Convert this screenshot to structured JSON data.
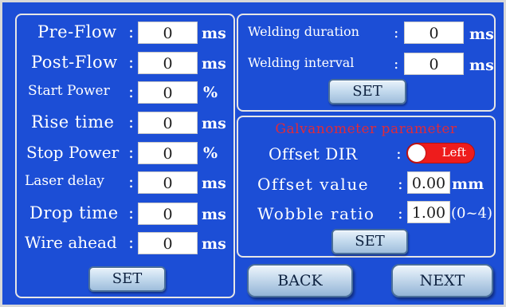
{
  "left": {
    "rows": [
      {
        "label": "Pre-Flow",
        "colon": ":",
        "value": "0",
        "unit": "ms"
      },
      {
        "label": "Post-Flow",
        "colon": ":",
        "value": "0",
        "unit": "ms"
      },
      {
        "label": "Start Power",
        "colon": ":",
        "value": "0",
        "unit": "%"
      },
      {
        "label": "Rise time",
        "colon": ":",
        "value": "0",
        "unit": "ms"
      },
      {
        "label": "Stop Power",
        "colon": ":",
        "value": "0",
        "unit": "%"
      },
      {
        "label": "Laser delay",
        "colon": ":",
        "value": "0",
        "unit": "ms"
      },
      {
        "label": "Drop time",
        "colon": ":",
        "value": "0",
        "unit": "ms"
      },
      {
        "label": "Wire ahead",
        "colon": ":",
        "value": "0",
        "unit": "ms"
      }
    ],
    "set_label": "SET"
  },
  "welding": {
    "duration_label": "Welding duration",
    "duration_colon": ":",
    "duration_value": "0",
    "duration_unit": "ms",
    "interval_label": "Welding interval",
    "interval_colon": ":",
    "interval_value": "0",
    "interval_unit": "ms",
    "set_label": "SET"
  },
  "galvo": {
    "title": "Galvanometer parameter",
    "offset_dir_label": "Offset DIR",
    "offset_dir_colon": ":",
    "offset_dir_value": "Left",
    "offset_value_label": "Offset value",
    "offset_value_colon": ":",
    "offset_value": "0.00",
    "offset_value_unit": "mm",
    "wobble_label": "Wobble ratio",
    "wobble_colon": ":",
    "wobble_value": "1.00",
    "wobble_range": "(0~4)",
    "set_label": "SET"
  },
  "nav": {
    "back_label": "BACK",
    "next_label": "NEXT"
  },
  "colors": {
    "background": "#1c4ed6",
    "toggle_on": "#ee1c1c",
    "galvo_title": "#e02a3a"
  }
}
